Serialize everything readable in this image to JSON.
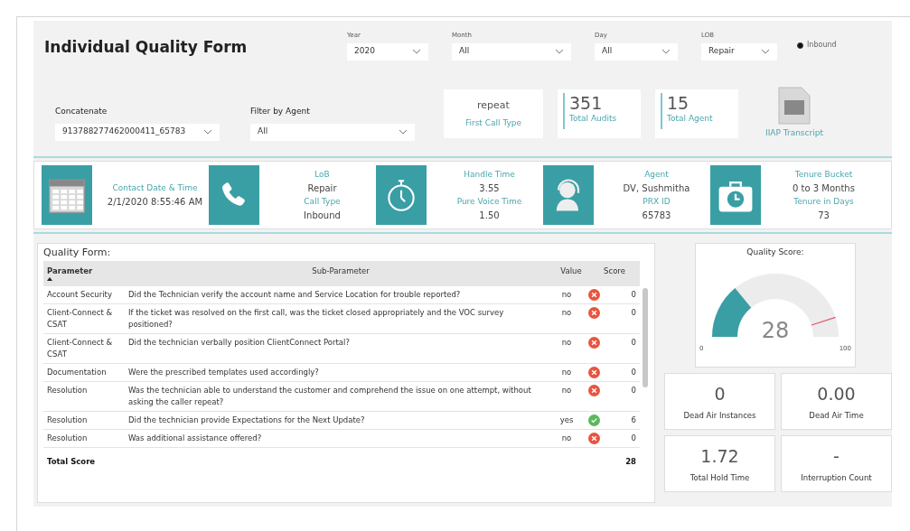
{
  "title": "Individual Quality Form",
  "slicers": [
    {
      "label": "Year",
      "value": "2020"
    },
    {
      "label": "Month",
      "value": "All"
    },
    {
      "label": "Day",
      "value": "All"
    },
    {
      "label": "LOB",
      "value": "Repair"
    }
  ],
  "call_direction": [
    {
      "label": "Inbound",
      "selected": true
    }
  ],
  "filters": [
    {
      "label": "Concatenate",
      "value": "913788277462000411_65783"
    },
    {
      "label": "Filter by Agent",
      "value": "All"
    }
  ],
  "kpi_cards": [
    {
      "kind": "plain",
      "value": "repeat",
      "label": "First Call Type"
    },
    {
      "kind": "accent",
      "value": "351",
      "label": "Total Audits"
    },
    {
      "kind": "accent",
      "value": "15",
      "label": "Total Agent"
    }
  ],
  "transcript": {
    "label": "IIAP Transcript"
  },
  "info_band": [
    {
      "kind": "calendar",
      "fields": [
        {
          "label": "Contact Date & Time",
          "value": "2/1/2020 8:55:46 AM"
        }
      ]
    },
    {
      "kind": "phone",
      "fields": [
        {
          "label": "LoB",
          "value": "Repair"
        },
        {
          "label": "Call Type",
          "value": "Inbound"
        }
      ]
    },
    {
      "kind": "stopwatch",
      "fields": [
        {
          "label": "Handle Time",
          "value": "3.55"
        },
        {
          "label": "Pure Voice Time",
          "value": "1.50"
        }
      ]
    },
    {
      "kind": "agent",
      "fields": [
        {
          "label": "Agent",
          "value": "DV, Sushmitha"
        },
        {
          "label": "PRX ID",
          "value": "65783"
        }
      ]
    },
    {
      "kind": "briefcase",
      "fields": [
        {
          "label": "Tenure Bucket",
          "value": "0 to 3 Months"
        },
        {
          "label": "Tenure in Days",
          "value": "73"
        }
      ]
    }
  ],
  "quality_form": {
    "title": "Quality Form:",
    "columns": [
      {
        "label": "Parameter",
        "sorted": true
      },
      {
        "label": "Sub-Parameter",
        "sorted": false
      },
      {
        "label": "Value",
        "sorted": false
      },
      {
        "label": "Score",
        "sorted": false
      }
    ],
    "rows": [
      {
        "parameter": "Account Security",
        "sub_parameter": "Did the Technician verify the account name and Service Location for trouble reported?",
        "value": "no",
        "kind": "fail",
        "score": "0"
      },
      {
        "parameter": "Client-Connect & CSAT",
        "sub_parameter": "If the ticket was resolved on the first call, was the ticket closed appropriately and the VOC survey positioned?",
        "value": "no",
        "kind": "fail",
        "score": "0"
      },
      {
        "parameter": "Client-Connect & CSAT",
        "sub_parameter": "Did the technician verbally position ClientConnect Portal?",
        "value": "no",
        "kind": "fail",
        "score": "0"
      },
      {
        "parameter": "Documentation",
        "sub_parameter": "Were the prescribed templates used accordingly?",
        "value": "no",
        "kind": "fail",
        "score": "0"
      },
      {
        "parameter": "Resolution",
        "sub_parameter": "Was the technician able to understand the customer and comprehend the issue on one attempt, without asking the caller repeat?",
        "value": "no",
        "kind": "fail",
        "score": "0"
      },
      {
        "parameter": "Resolution",
        "sub_parameter": "Did the technician provide Expectations for the Next Update?",
        "value": "yes",
        "kind": "pass",
        "score": "6"
      },
      {
        "parameter": "Resolution",
        "sub_parameter": "Was additional assistance offered?",
        "value": "no",
        "kind": "fail",
        "score": "0"
      }
    ],
    "total": {
      "label": "Total Score",
      "score": "28"
    }
  },
  "quality_score": {
    "title": "Quality Score:",
    "value": "28",
    "level": 0.28,
    "min": "0",
    "max": "100"
  },
  "stat_cards": [
    {
      "value": "0",
      "label": "Dead Air Instances"
    },
    {
      "value": "0.00",
      "label": "Dead Air Time"
    },
    {
      "value": "1.72",
      "label": "Total Hold Time"
    },
    {
      "value": "-",
      "label": "Interruption Count"
    }
  ]
}
